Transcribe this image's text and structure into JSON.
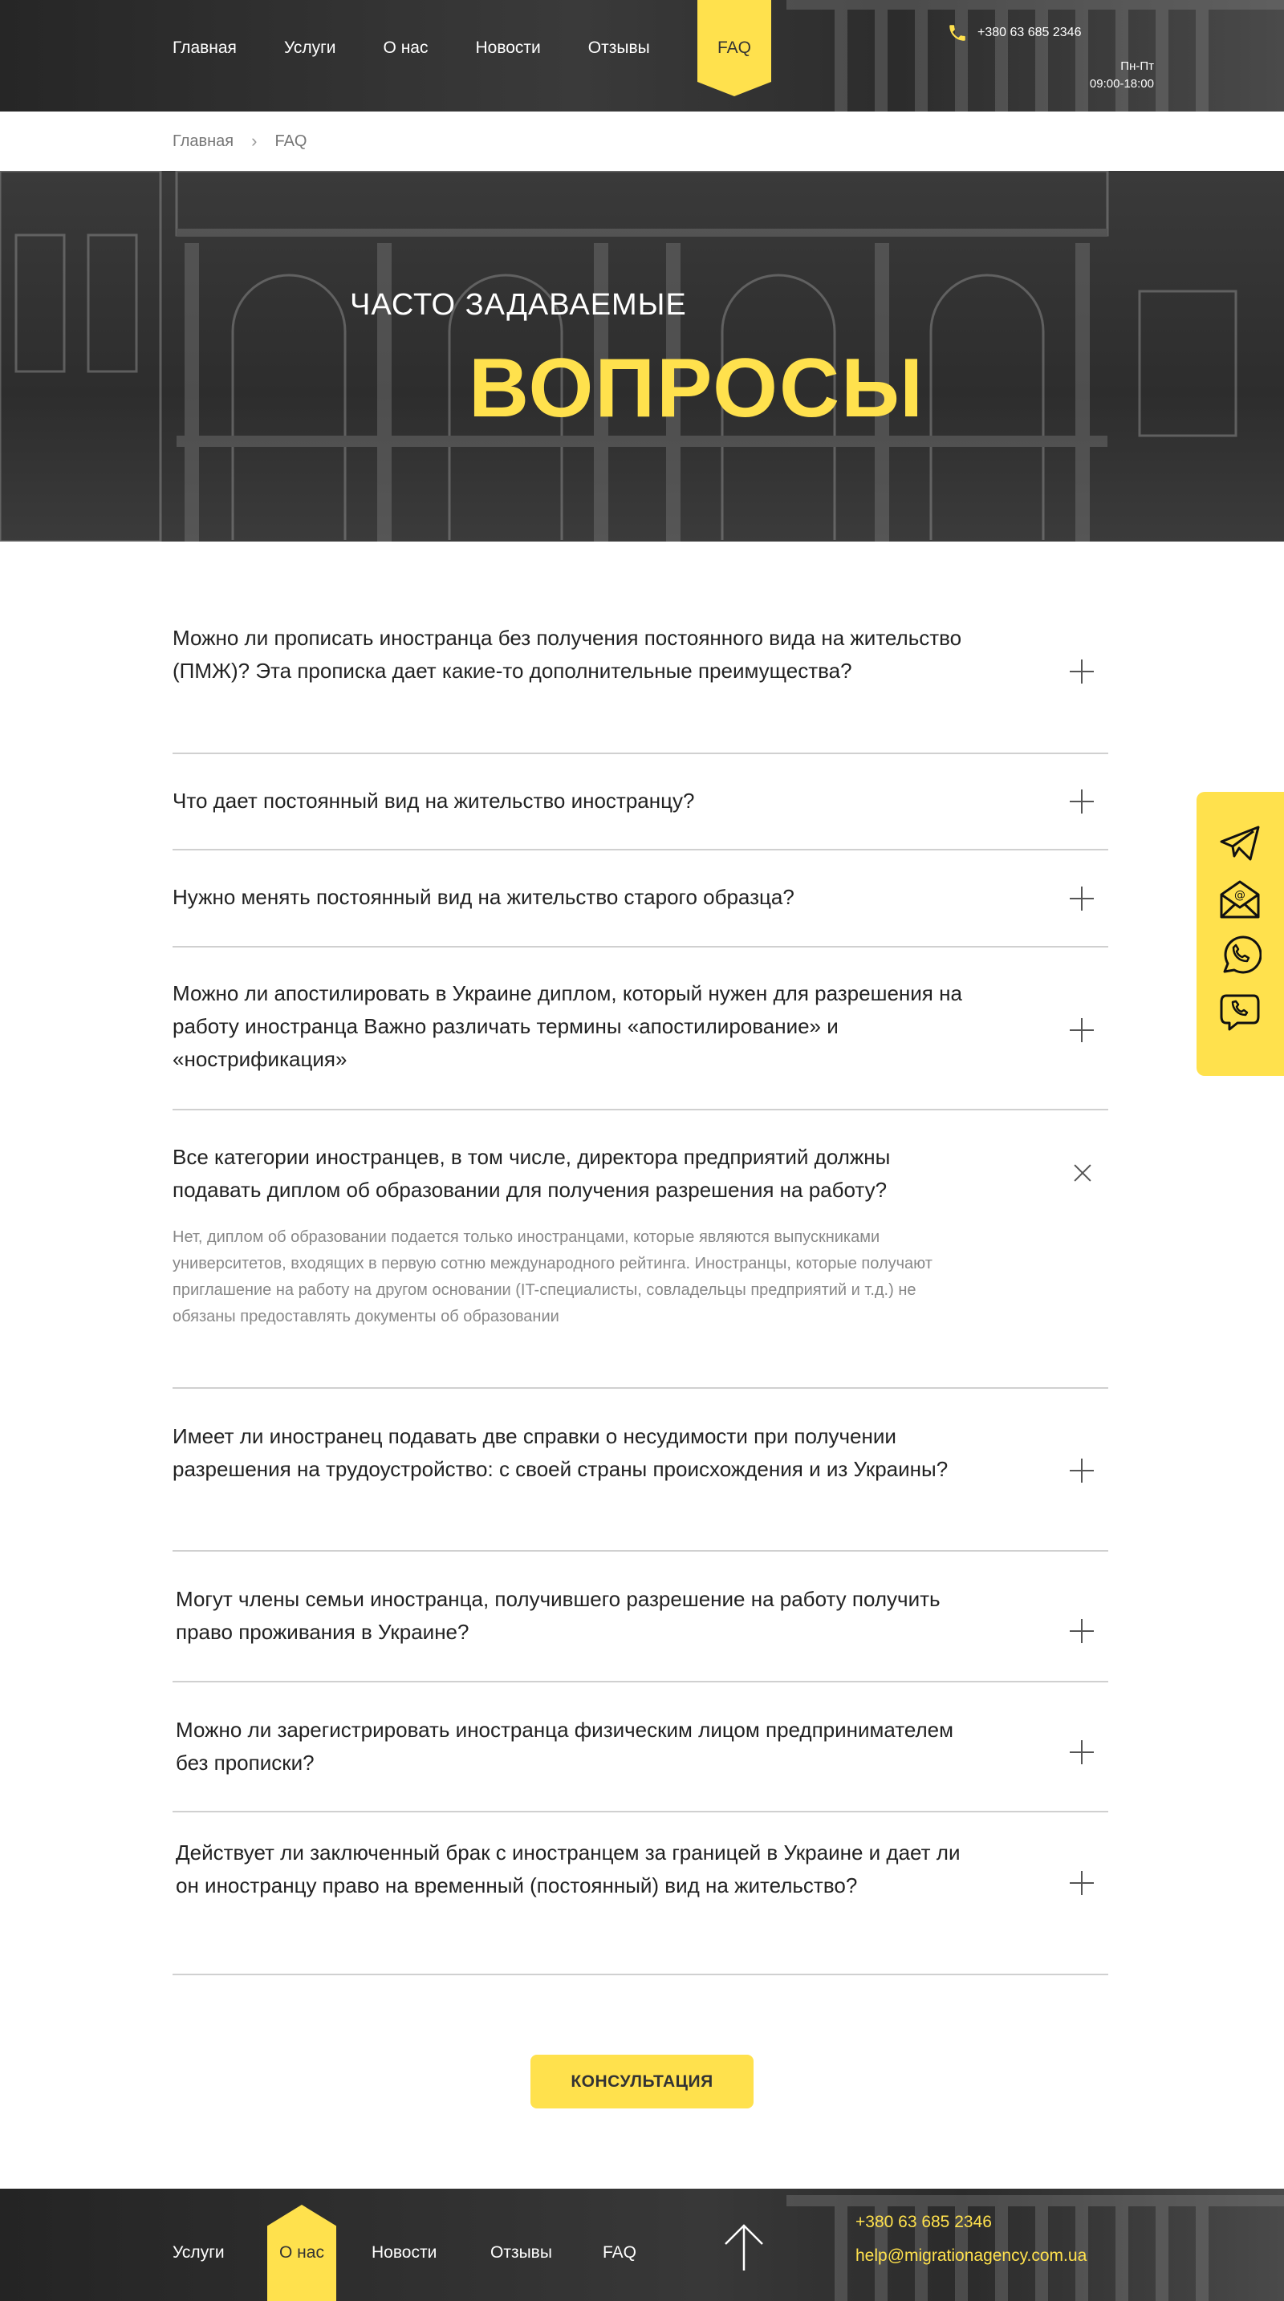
{
  "header": {
    "nav": [
      {
        "label": "Главная"
      },
      {
        "label": "Услуги"
      },
      {
        "label": "О нас"
      },
      {
        "label": "Новости"
      },
      {
        "label": "Отзывы"
      },
      {
        "label": "FAQ",
        "active": true
      }
    ],
    "phone": "+380 63 685 2346",
    "days": "Пн-Пт",
    "hours": "09:00-18:00"
  },
  "breadcrumb": {
    "home": "Главная",
    "current": "FAQ"
  },
  "hero": {
    "subtitle": "ЧАСТО ЗАДАВАЕМЫЕ",
    "title": "ВОПРОСЫ"
  },
  "faq": [
    {
      "question": "Можно ли прописать иностранца без получения постоянного вида на жительство (ПМЖ)? Эта прописка дает какие-то дополнительные преимущества?",
      "open": false
    },
    {
      "question": "Что дает постоянный вид на жительство иностранцу?",
      "open": false
    },
    {
      "question": "Нужно менять постоянный вид на жительство старого образца?",
      "open": false
    },
    {
      "question": "Можно ли апостилировать в Украине диплом, который нужен для разрешения на работу иностранца Важно различать термины «апостилирование» и «нострификация»",
      "open": false
    },
    {
      "question": "Все категории иностранцев, в том числе, директора предприятий должны подавать диплом об образовании для получения разрешения на работу?",
      "open": true,
      "answer": "Нет, диплом об образовании подается только иностранцами, которые являются выпускниками университетов, входящих в первую сотню международного рейтинга. Иностранцы, которые получают приглашение на работу на другом основании (IT-специалисты, совладельцы предприятий и т.д.) не обязаны предоставлять документы об образовании"
    },
    {
      "question": "Имеет ли иностранец подавать две справки о несудимости при получении разрешения на трудоустройство: с своей страны происхождения и из Украины?",
      "open": false
    },
    {
      "question": "Могут члены семьи иностранца, получившего разрешение на работу получить право проживания в Украине?",
      "open": false
    },
    {
      "question": "Можно ли зарегистрировать иностранца физическим лицом предпринимателем без прописки?",
      "open": false
    },
    {
      "question": "Действует ли заключенный брак с иностранцем за границей в Украине и дает ли он иностранцу право на временный (постоянный) вид на жительство?",
      "open": false
    }
  ],
  "side_widget": {
    "icons": [
      "telegram-icon",
      "email-icon",
      "whatsapp-icon",
      "viber-icon"
    ]
  },
  "consult_button": "КОНСУЛЬТАЦИЯ",
  "footer": {
    "nav": [
      {
        "label": "Услуги"
      },
      {
        "label": "О нас",
        "active": true
      },
      {
        "label": "Новости"
      },
      {
        "label": "Отзывы"
      },
      {
        "label": "FAQ"
      }
    ],
    "phone": "+380 63 685 2346",
    "email": "help@migrationagency.com.ua"
  },
  "colors": {
    "accent": "#ffe14d",
    "dark": "#2d2d2d",
    "divider": "#d0d0d0",
    "answer_text": "#888888"
  }
}
